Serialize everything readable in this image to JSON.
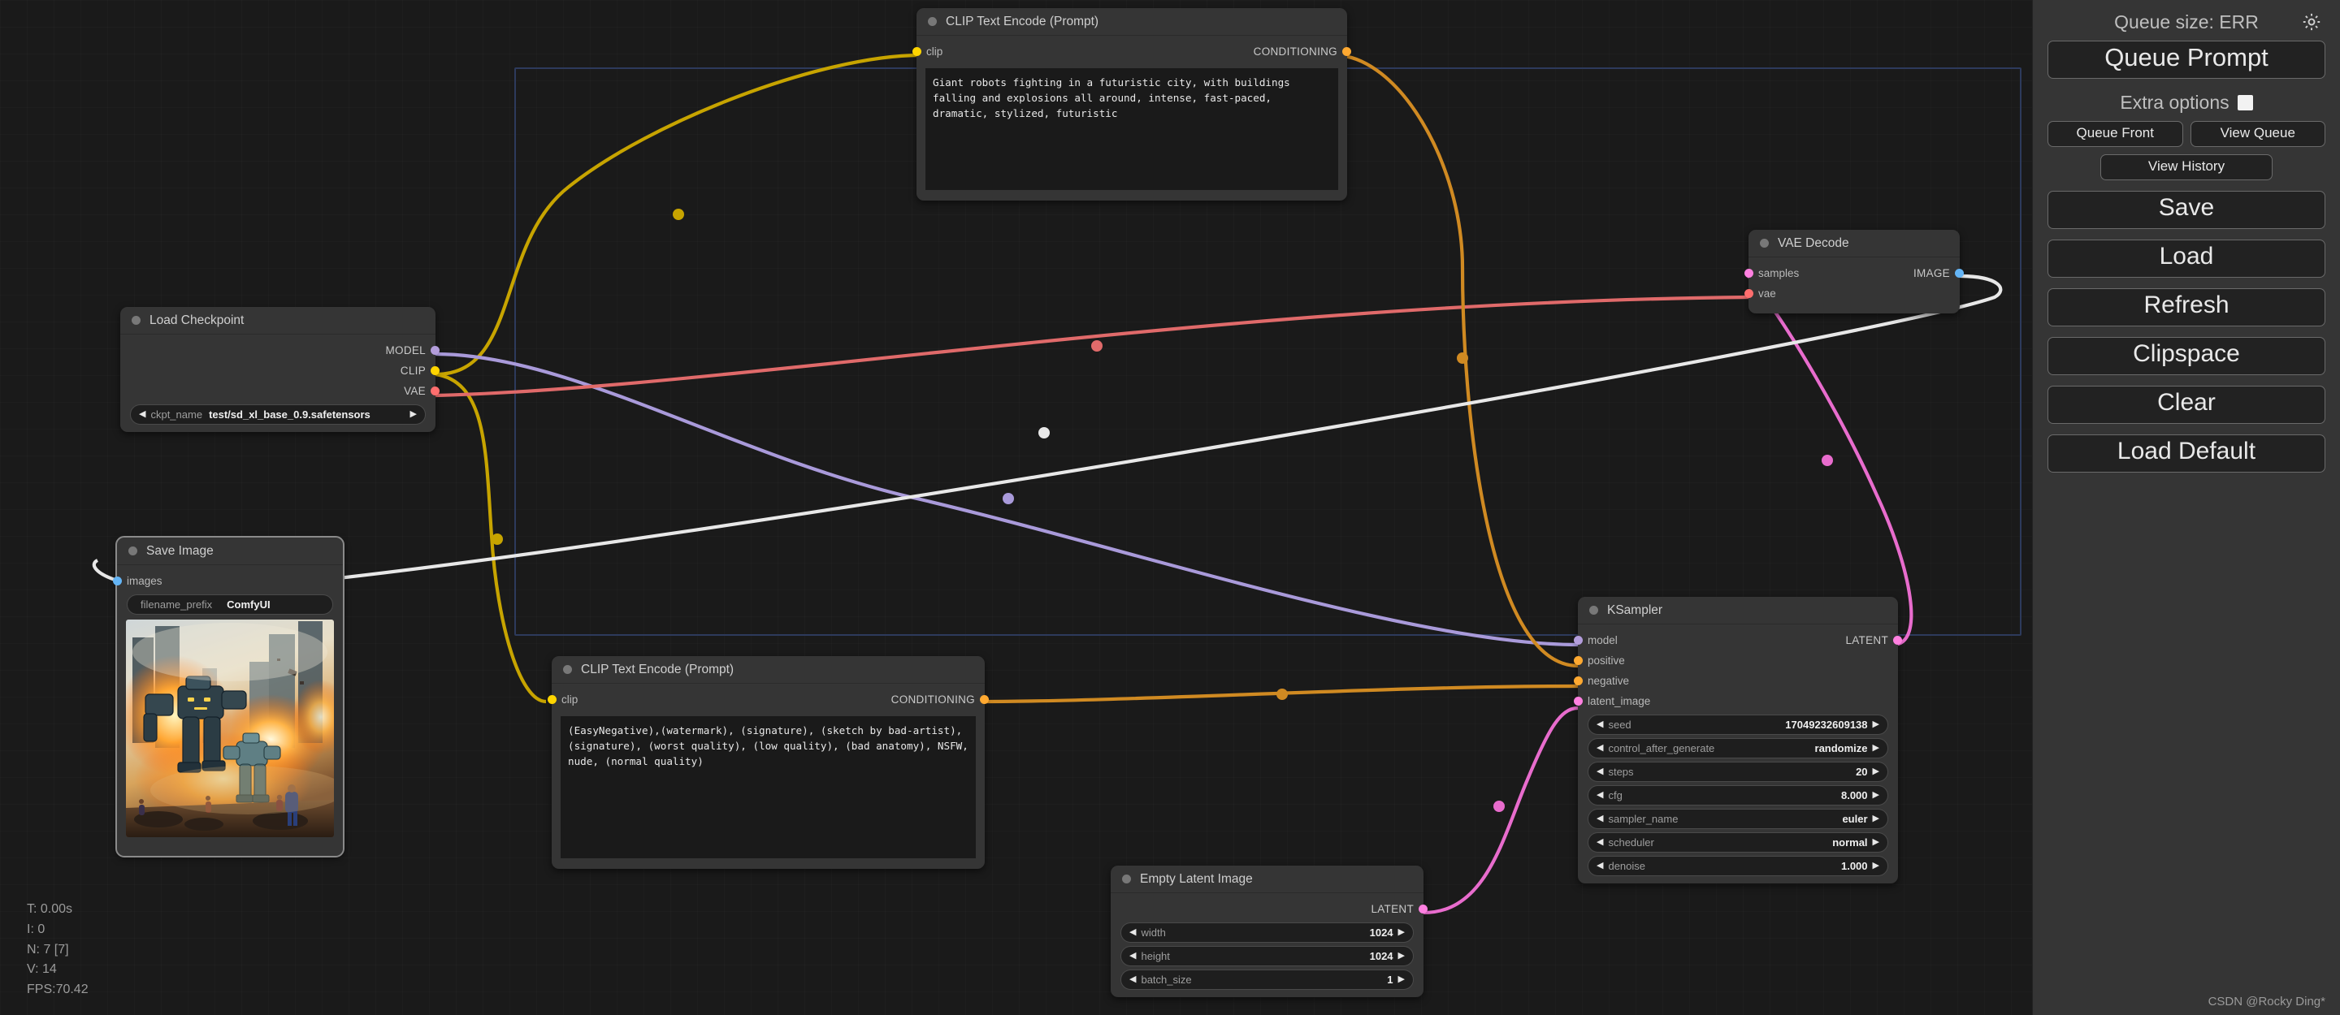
{
  "app": {
    "name": "ComfyUI",
    "watermark": "CSDN @Rocky Ding*"
  },
  "sidebar": {
    "queue_size_label": "Queue size: ERR",
    "gear_icon": "gear-icon",
    "queue_prompt_label": "Queue Prompt",
    "extra_options_label": "Extra options",
    "extra_options_checked": false,
    "queue_front_label": "Queue Front",
    "view_queue_label": "View Queue",
    "view_history_label": "View History",
    "save_label": "Save",
    "load_label": "Load",
    "refresh_label": "Refresh",
    "clipspace_label": "Clipspace",
    "clear_label": "Clear",
    "load_default_label": "Load Default"
  },
  "status": {
    "time": "T: 0.00s",
    "iterations": "I: 0",
    "nodes": "N: 7 [7]",
    "version": "V: 14",
    "fps": "FPS:70.42"
  },
  "colors": {
    "model": "#b39ddb",
    "clip": "#ffd500",
    "vae": "#ff6e6e",
    "conditioning": "#ffa931",
    "latent": "#ff80e0",
    "image": "#64b5f6",
    "node_bg": "#353535",
    "canvas_bg": "#1a1a1a",
    "group_frame": "#2d3a5c"
  },
  "nodes": {
    "clip_positive": {
      "title": "CLIP Text Encode (Prompt)",
      "input_label": "clip",
      "output_label": "CONDITIONING",
      "text": "Giant robots fighting in a futuristic city, with buildings falling and explosions all around, intense, fast-paced, dramatic, stylized, futuristic"
    },
    "clip_negative": {
      "title": "CLIP Text Encode (Prompt)",
      "input_label": "clip",
      "output_label": "CONDITIONING",
      "text": "(EasyNegative),(watermark), (signature), (sketch by bad-artist), (signature), (worst quality), (low quality), (bad anatomy), NSFW, nude, (normal quality)"
    },
    "load_checkpoint": {
      "title": "Load Checkpoint",
      "outputs": [
        "MODEL",
        "CLIP",
        "VAE"
      ],
      "widget_name": "ckpt_name",
      "widget_value": "test/sd_xl_base_0.9.safetensors"
    },
    "vae_decode": {
      "title": "VAE Decode",
      "inputs": [
        "samples",
        "vae"
      ],
      "output_label": "IMAGE"
    },
    "save_image": {
      "title": "Save Image",
      "input_label": "images",
      "widget_name": "filename_prefix",
      "widget_value": "ComfyUI",
      "preview_alt": "generated-image-giant-robots-burning-city"
    },
    "ksampler": {
      "title": "KSampler",
      "inputs": [
        "model",
        "positive",
        "negative",
        "latent_image"
      ],
      "output_label": "LATENT",
      "widgets": [
        {
          "name": "seed",
          "value": "17049232609138"
        },
        {
          "name": "control_after_generate",
          "value": "randomize"
        },
        {
          "name": "steps",
          "value": "20"
        },
        {
          "name": "cfg",
          "value": "8.000"
        },
        {
          "name": "sampler_name",
          "value": "euler"
        },
        {
          "name": "scheduler",
          "value": "normal"
        },
        {
          "name": "denoise",
          "value": "1.000"
        }
      ]
    },
    "empty_latent": {
      "title": "Empty Latent Image",
      "output_label": "LATENT",
      "widgets": [
        {
          "name": "width",
          "value": "1024"
        },
        {
          "name": "height",
          "value": "1024"
        },
        {
          "name": "batch_size",
          "value": "1"
        }
      ]
    }
  }
}
